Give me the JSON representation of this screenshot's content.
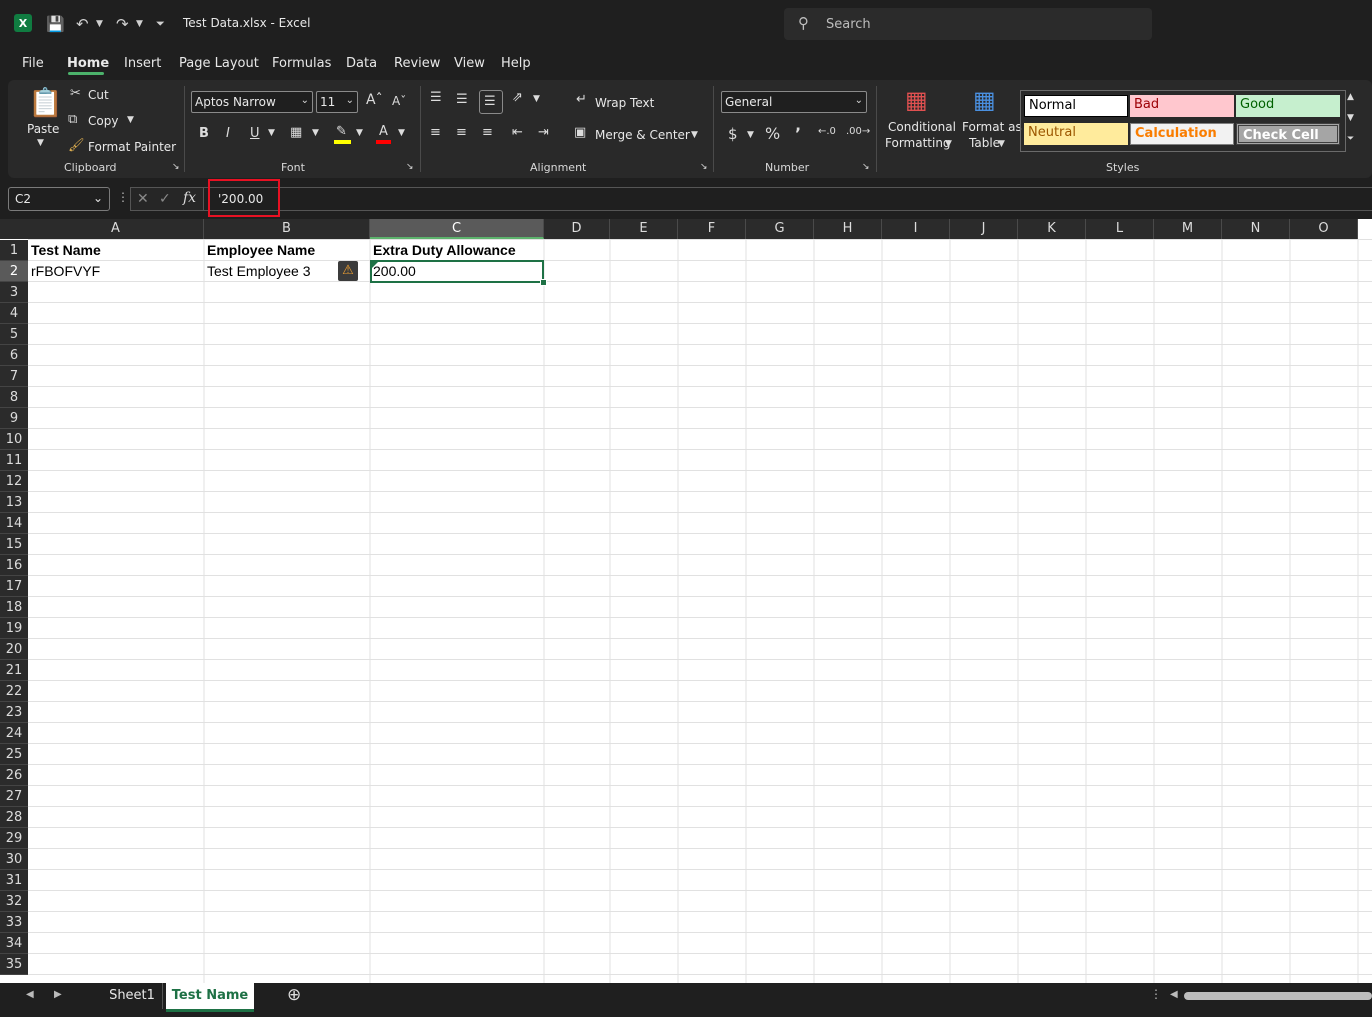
{
  "titlebar": {
    "title": "Test Data.xlsx  -  Excel",
    "search_placeholder": "Search"
  },
  "menu": {
    "tabs": [
      "File",
      "Home",
      "Insert",
      "Page Layout",
      "Formulas",
      "Data",
      "Review",
      "View",
      "Help"
    ],
    "active": "Home"
  },
  "ribbon": {
    "clipboard": {
      "paste": "Paste",
      "cut": "Cut",
      "copy": "Copy",
      "format_painter": "Format Painter",
      "label": "Clipboard"
    },
    "font": {
      "name": "Aptos Narrow",
      "size": "11",
      "label": "Font",
      "bold": "B",
      "italic": "I",
      "underline": "U"
    },
    "alignment": {
      "wrap_text": "Wrap Text",
      "merge_center": "Merge & Center",
      "label": "Alignment"
    },
    "number": {
      "format": "General",
      "label": "Number"
    },
    "styles": {
      "conditional_formatting_1": "Conditional",
      "conditional_formatting_2": "Formatting",
      "format_as_table_1": "Format as",
      "format_as_table_2": "Table",
      "normal": "Normal",
      "bad": "Bad",
      "good": "Good",
      "neutral": "Neutral",
      "calculation": "Calculation",
      "check_cell": "Check Cell",
      "label": "Styles"
    }
  },
  "formula_bar": {
    "name_box": "C2",
    "value": "'200.00"
  },
  "grid": {
    "columns": [
      "A",
      "B",
      "C",
      "D",
      "E",
      "F",
      "G",
      "H",
      "I",
      "J",
      "K",
      "L",
      "M",
      "N",
      "O"
    ],
    "selected_column": "C",
    "selected_row": "2",
    "rows": [
      "1",
      "2",
      "3",
      "4",
      "5",
      "6",
      "7",
      "8",
      "9",
      "10",
      "11",
      "12",
      "13",
      "14",
      "15",
      "16",
      "17",
      "18",
      "19",
      "20",
      "21",
      "22",
      "23",
      "24",
      "25",
      "26",
      "27",
      "28",
      "29",
      "30",
      "31",
      "32",
      "33",
      "34",
      "35"
    ],
    "headers": {
      "a1": "Test Name",
      "b1": "Employee Name",
      "c1": "Extra Duty Allowance"
    },
    "row2": {
      "a2": "rFBOFVYF",
      "b2": "Test Employee 3",
      "c2": "200.00"
    }
  },
  "sheets": {
    "tabs": [
      "Sheet1",
      "Test Name"
    ],
    "active": "Test Name"
  },
  "colors": {
    "accent": "#1e7145",
    "highlight": "#e81123"
  }
}
